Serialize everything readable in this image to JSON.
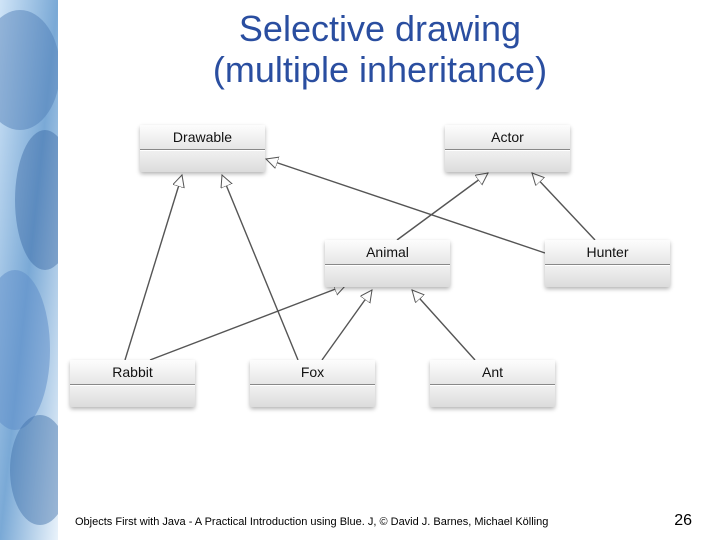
{
  "title_line1": "Selective drawing",
  "title_line2": "(multiple inheritance)",
  "footer": "Objects First with Java - A Practical Introduction using Blue. J, © David J. Barnes, Michael Kölling",
  "page_number": "26",
  "classes": {
    "drawable": "Drawable",
    "actor": "Actor",
    "animal": "Animal",
    "hunter": "Hunter",
    "rabbit": "Rabbit",
    "fox": "Fox",
    "ant": "Ant"
  },
  "relationships": [
    {
      "from": "animal",
      "to": "actor",
      "type": "generalization"
    },
    {
      "from": "hunter",
      "to": "actor",
      "type": "generalization"
    },
    {
      "from": "hunter",
      "to": "drawable",
      "type": "generalization"
    },
    {
      "from": "rabbit",
      "to": "animal",
      "type": "generalization"
    },
    {
      "from": "rabbit",
      "to": "drawable",
      "type": "generalization"
    },
    {
      "from": "fox",
      "to": "animal",
      "type": "generalization"
    },
    {
      "from": "fox",
      "to": "drawable",
      "type": "generalization"
    },
    {
      "from": "ant",
      "to": "animal",
      "type": "generalization"
    }
  ]
}
